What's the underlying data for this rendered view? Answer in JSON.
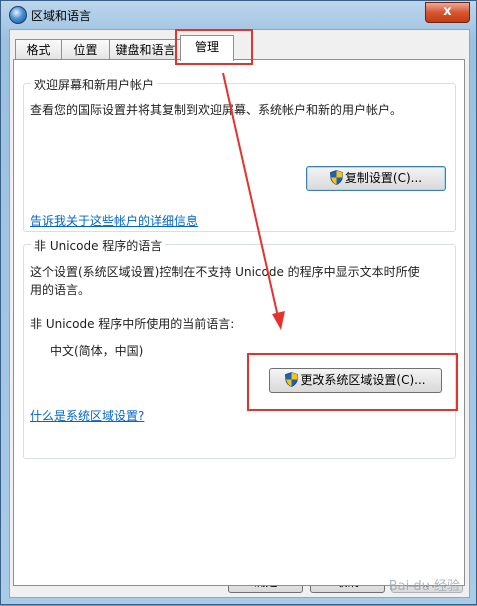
{
  "window": {
    "title": "区域和语言",
    "close_glyph": "x"
  },
  "tabs": [
    {
      "label": "格式"
    },
    {
      "label": "位置"
    },
    {
      "label": "键盘和语言"
    },
    {
      "label": "管理"
    }
  ],
  "welcome_group": {
    "title": "欢迎屏幕和新用户帐户",
    "description": "查看您的国际设置并将其复制到欢迎屏幕、系统帐户和新的用户帐户。",
    "copy_button": "复制设置(C)...",
    "link": "告诉我关于这些帐户的详细信息"
  },
  "unicode_group": {
    "title": "非 Unicode 程序的语言",
    "description_line1": "这个设置(系统区域设置)控制在不支持 Unicode 的程序中显示文本时所使",
    "description_line2": "用的语言。",
    "current_label": "非 Unicode 程序中所使用的当前语言:",
    "current_value": "中文(简体，中国)",
    "change_button": "更改系统区域设置(C)...",
    "link": "什么是系统区域设置?"
  },
  "footer": {
    "ok": "确定",
    "cancel": "取消",
    "apply": "应用(A)"
  },
  "watermark": "Bai du 经验",
  "colors": {
    "annotation": "#e6322c",
    "link": "#0066cc"
  }
}
